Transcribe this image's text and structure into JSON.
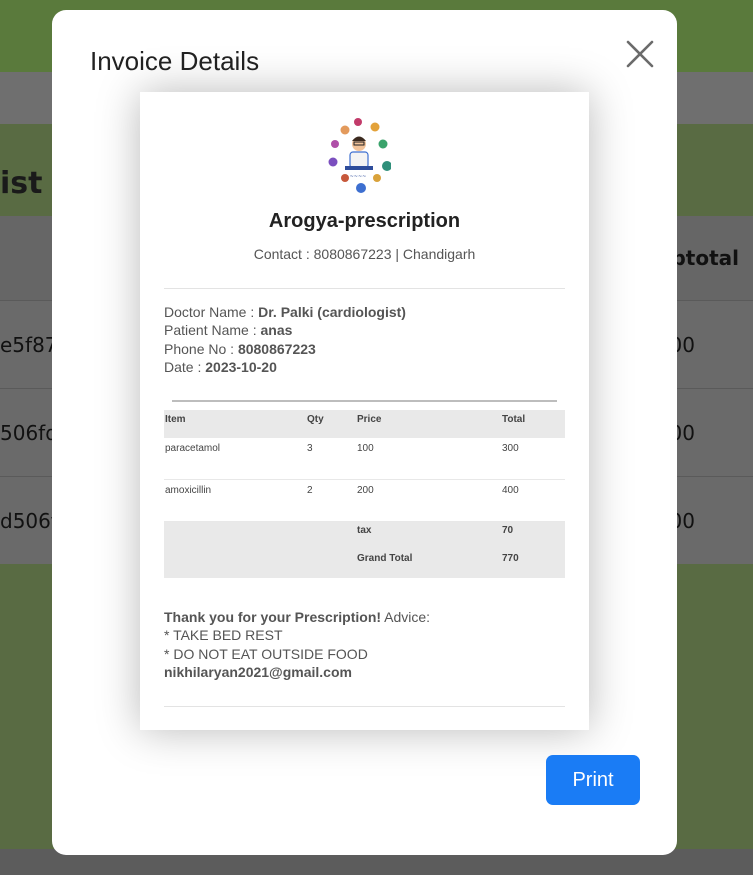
{
  "background": {
    "title_fragment": "ist",
    "column_header_fragment": "ıbtotal",
    "rows": [
      {
        "left": "e5f87",
        "right": "00"
      },
      {
        "left": "506fd",
        "right": "00"
      },
      {
        "left": "d506fc",
        "right": "700"
      }
    ]
  },
  "modal": {
    "title": "Invoice Details",
    "close_icon": "close-icon",
    "print_label": "Print",
    "accent_color": "#1a7cf5"
  },
  "invoice": {
    "brand": "Arogya-prescription",
    "contact": "Contact : 8080867223 | Chandigarh",
    "doctor_label": "Doctor Name : ",
    "doctor_value": "Dr. Palki (cardiologist)",
    "patient_label": "Patient Name : ",
    "patient_value": "anas",
    "phone_label": "Phone No : ",
    "phone_value": "8080867223",
    "date_label": "Date : ",
    "date_value": "2023-10-20",
    "columns": [
      "Item",
      "Qty",
      "Price",
      "Total"
    ],
    "items": [
      {
        "name": "paracetamol",
        "qty": "3",
        "price": "100",
        "total": "300"
      },
      {
        "name": "amoxicillin",
        "qty": "2",
        "price": "200",
        "total": "400"
      }
    ],
    "tax_label": "tax",
    "tax_value": "70",
    "grand_total_label": "Grand Total",
    "grand_total_value": "770",
    "thanks": "Thank you for your Prescription!",
    "advice_label": " Advice:",
    "advice_lines": [
      "* TAKE BED REST",
      "* DO NOT EAT OUTSIDE FOOD"
    ],
    "email": "nikhilaryan2021@gmail.com",
    "logo_icon": "doctor-network-logo-icon"
  }
}
